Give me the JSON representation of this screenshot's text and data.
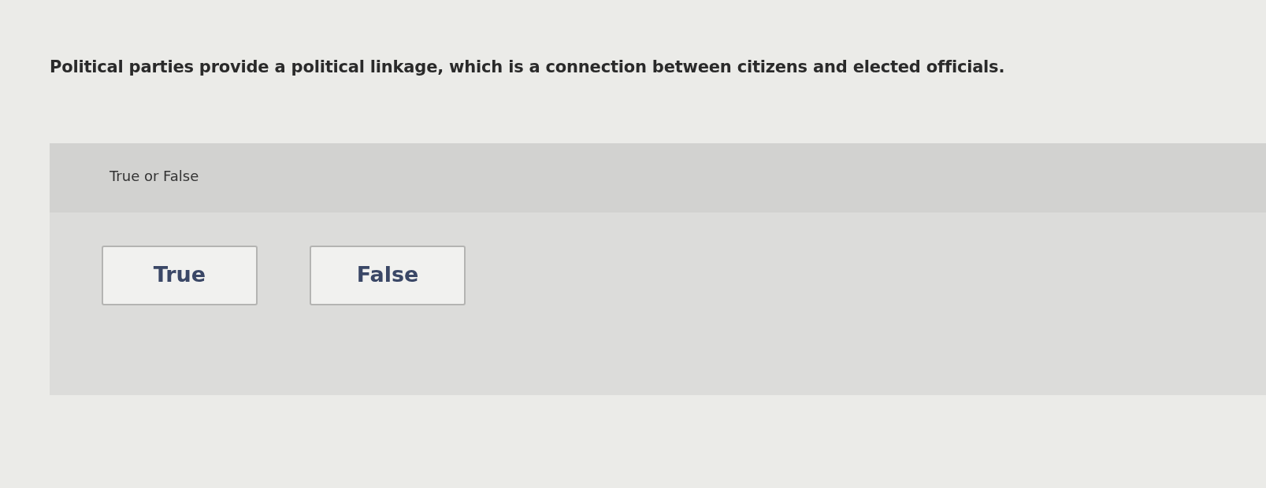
{
  "question": {
    "text": "Political parties provide a political linkage, which is a connection between citizens and elected officials."
  },
  "answer_panel": {
    "prompt": "True or False",
    "options": [
      {
        "label": "True",
        "selected": false
      },
      {
        "label": "False",
        "selected": false
      }
    ]
  }
}
